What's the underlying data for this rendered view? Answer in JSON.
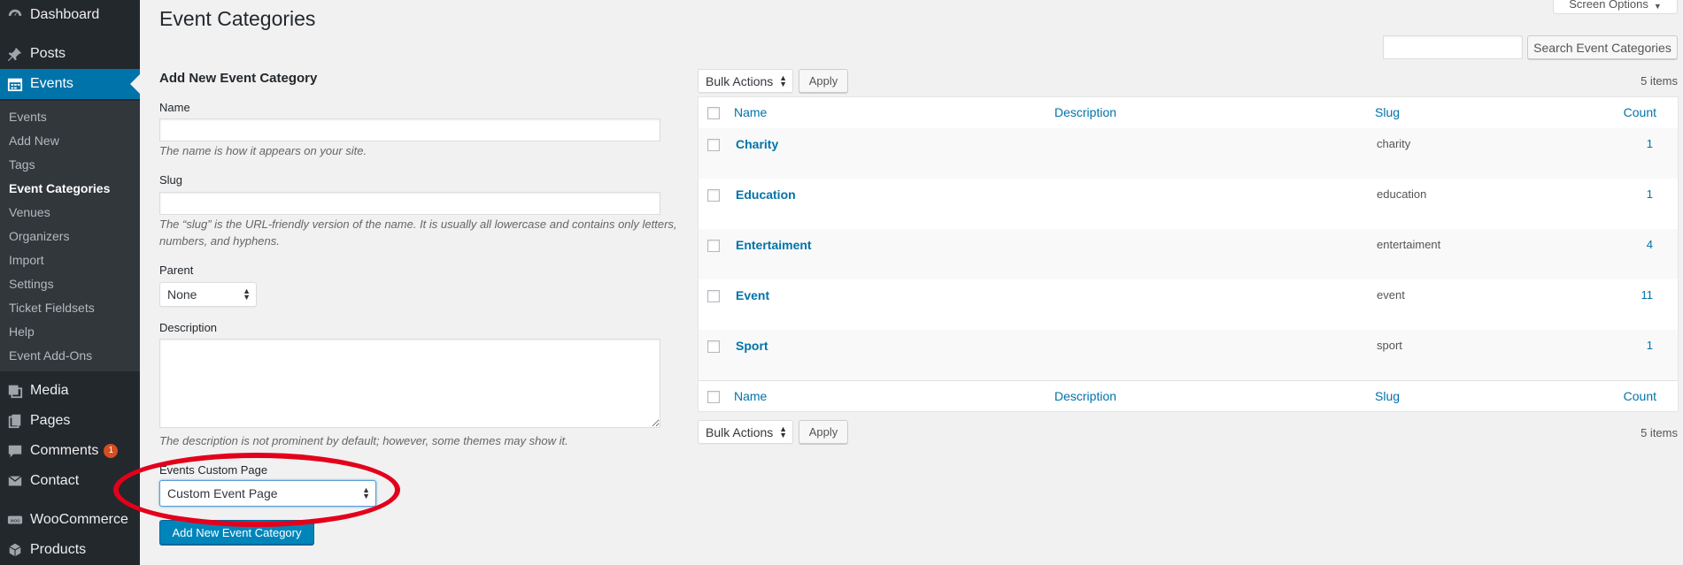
{
  "sidebar": {
    "top_items": [
      {
        "label": "Dashboard",
        "icon": "dashboard-icon"
      },
      {
        "label": "Posts",
        "icon": "pin-icon"
      },
      {
        "label": "Events",
        "icon": "calendar-icon"
      }
    ],
    "submenu": [
      "Events",
      "Add New",
      "Tags",
      "Event Categories",
      "Venues",
      "Organizers",
      "Import",
      "Settings",
      "Ticket Fieldsets",
      "Help",
      "Event Add-Ons"
    ],
    "bottom_items": [
      {
        "label": "Media",
        "icon": "media-icon"
      },
      {
        "label": "Pages",
        "icon": "pages-icon"
      },
      {
        "label": "Comments",
        "icon": "comment-icon",
        "badge": "1"
      },
      {
        "label": "Contact",
        "icon": "mail-icon"
      },
      {
        "label": "WooCommerce",
        "icon": "woocommerce-icon"
      },
      {
        "label": "Products",
        "icon": "products-icon"
      }
    ]
  },
  "header": {
    "title": "Event Categories",
    "screen_options": "Screen Options",
    "search_button": "Search Event Categories"
  },
  "form": {
    "heading": "Add New Event Category",
    "name_label": "Name",
    "name_help": "The name is how it appears on your site.",
    "slug_label": "Slug",
    "slug_help": "The “slug” is the URL-friendly version of the name. It is usually all lowercase and contains only letters, numbers, and hyphens.",
    "parent_label": "Parent",
    "parent_value": "None",
    "description_label": "Description",
    "description_help": "The description is not prominent by default; however, some themes may show it.",
    "custom_page_label": "Events Custom Page",
    "custom_page_value": "Custom Event Page",
    "submit_label": "Add New Event Category"
  },
  "table": {
    "bulk_actions": "Bulk Actions",
    "apply": "Apply",
    "items_count": "5 items",
    "columns": {
      "name": "Name",
      "description": "Description",
      "slug": "Slug",
      "count": "Count"
    },
    "rows": [
      {
        "name": "Charity",
        "slug": "charity",
        "count": "1"
      },
      {
        "name": "Education",
        "slug": "education",
        "count": "1"
      },
      {
        "name": "Entertaiment",
        "slug": "entertaiment",
        "count": "4"
      },
      {
        "name": "Event",
        "slug": "event",
        "count": "11"
      },
      {
        "name": "Sport",
        "slug": "sport",
        "count": "1"
      }
    ]
  },
  "colors": {
    "sidebar_bg": "#23282d",
    "accent": "#0073aa",
    "primary_button": "#0085ba",
    "annotation": "#e3001b"
  }
}
